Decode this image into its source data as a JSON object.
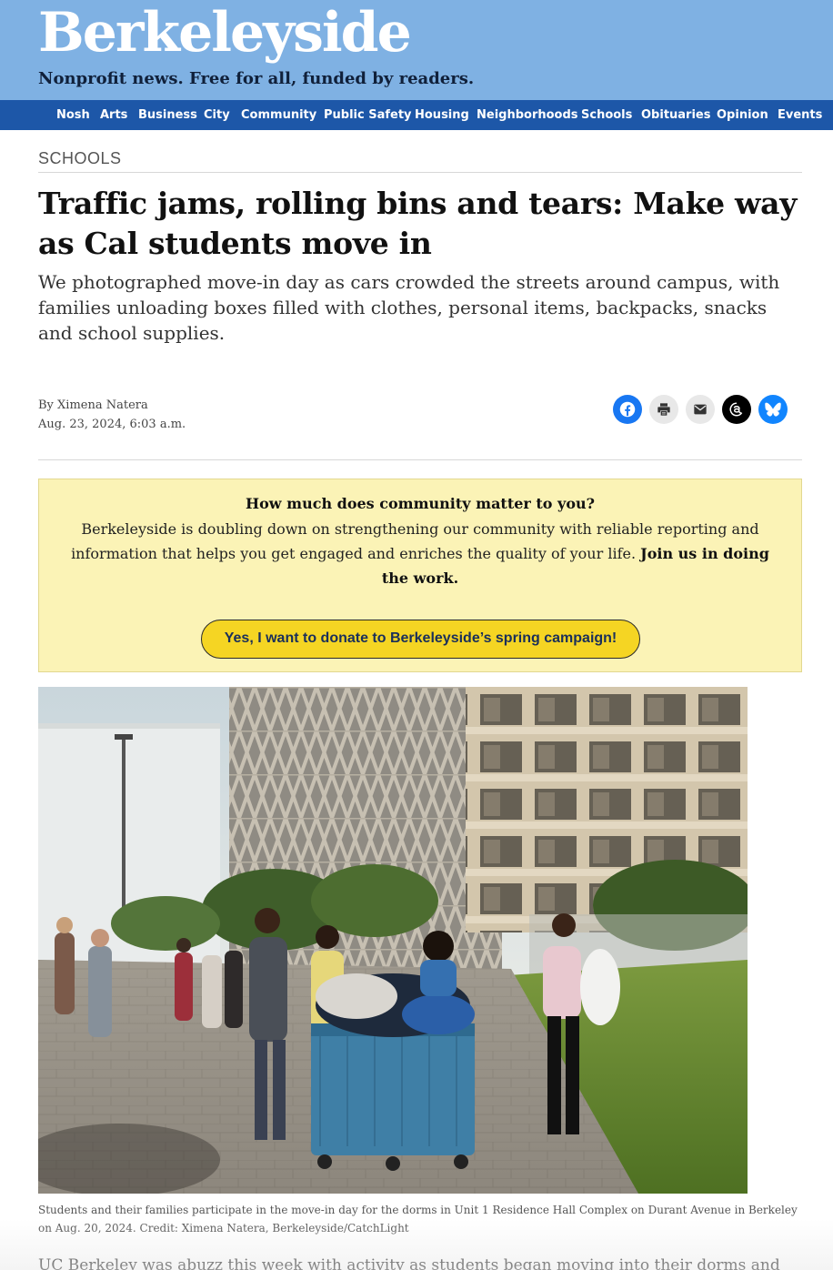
{
  "site": {
    "name": "Berkeleyside",
    "tagline": "Nonprofit news. Free for all, funded by readers.",
    "colors": {
      "masthead": "#7fb1e3",
      "nav": "#1d57a8",
      "donate_bg": "#fbf3b6",
      "donate_button": "#f5d523"
    }
  },
  "nav": {
    "items": [
      {
        "label": "Nosh"
      },
      {
        "label": "Arts"
      },
      {
        "label": "Business"
      },
      {
        "label": "City"
      },
      {
        "label": "Community"
      },
      {
        "label": "Public Safety"
      },
      {
        "label": "Housing"
      },
      {
        "label": "Neighborhoods"
      },
      {
        "label": "Schools"
      },
      {
        "label": "Obituaries"
      },
      {
        "label": "Opinion"
      },
      {
        "label": "Events"
      }
    ]
  },
  "article": {
    "section": "SCHOOLS",
    "headline": "Traffic jams, rolling bins and tears: Make way as Cal students move in",
    "dek": "We photographed move-in day as cars crowded the streets around campus, with families unloading boxes filled with clothes, personal items, backpacks, snacks and school supplies.",
    "byline": "By Ximena Natera",
    "date": "Aug. 23, 2024, 6:03 a.m.",
    "share": [
      {
        "icon": "facebook-icon"
      },
      {
        "icon": "print-icon"
      },
      {
        "icon": "email-icon"
      },
      {
        "icon": "threads-icon"
      },
      {
        "icon": "bluesky-icon"
      }
    ],
    "caption": "Students and their families participate in the move-in day for the dorms in Unit 1 Residence Hall Complex on Durant Avenue in Berkeley on Aug. 20, 2024. Credit: Ximena Natera, Berkeleyside/CatchLight",
    "body_first_line": "UC Berkeley was abuzz this week with activity as students began moving into their dorms and"
  },
  "donate": {
    "title": "How much does community matter to you?",
    "text": "Berkeleyside is doubling down on strengthening our community with reliable reporting and information that helps you get engaged and enriches the quality of your life.",
    "text_bold": "Join us in doing the work.",
    "button_label": "Yes, I want to donate to Berkeleyside’s spring campaign!"
  }
}
